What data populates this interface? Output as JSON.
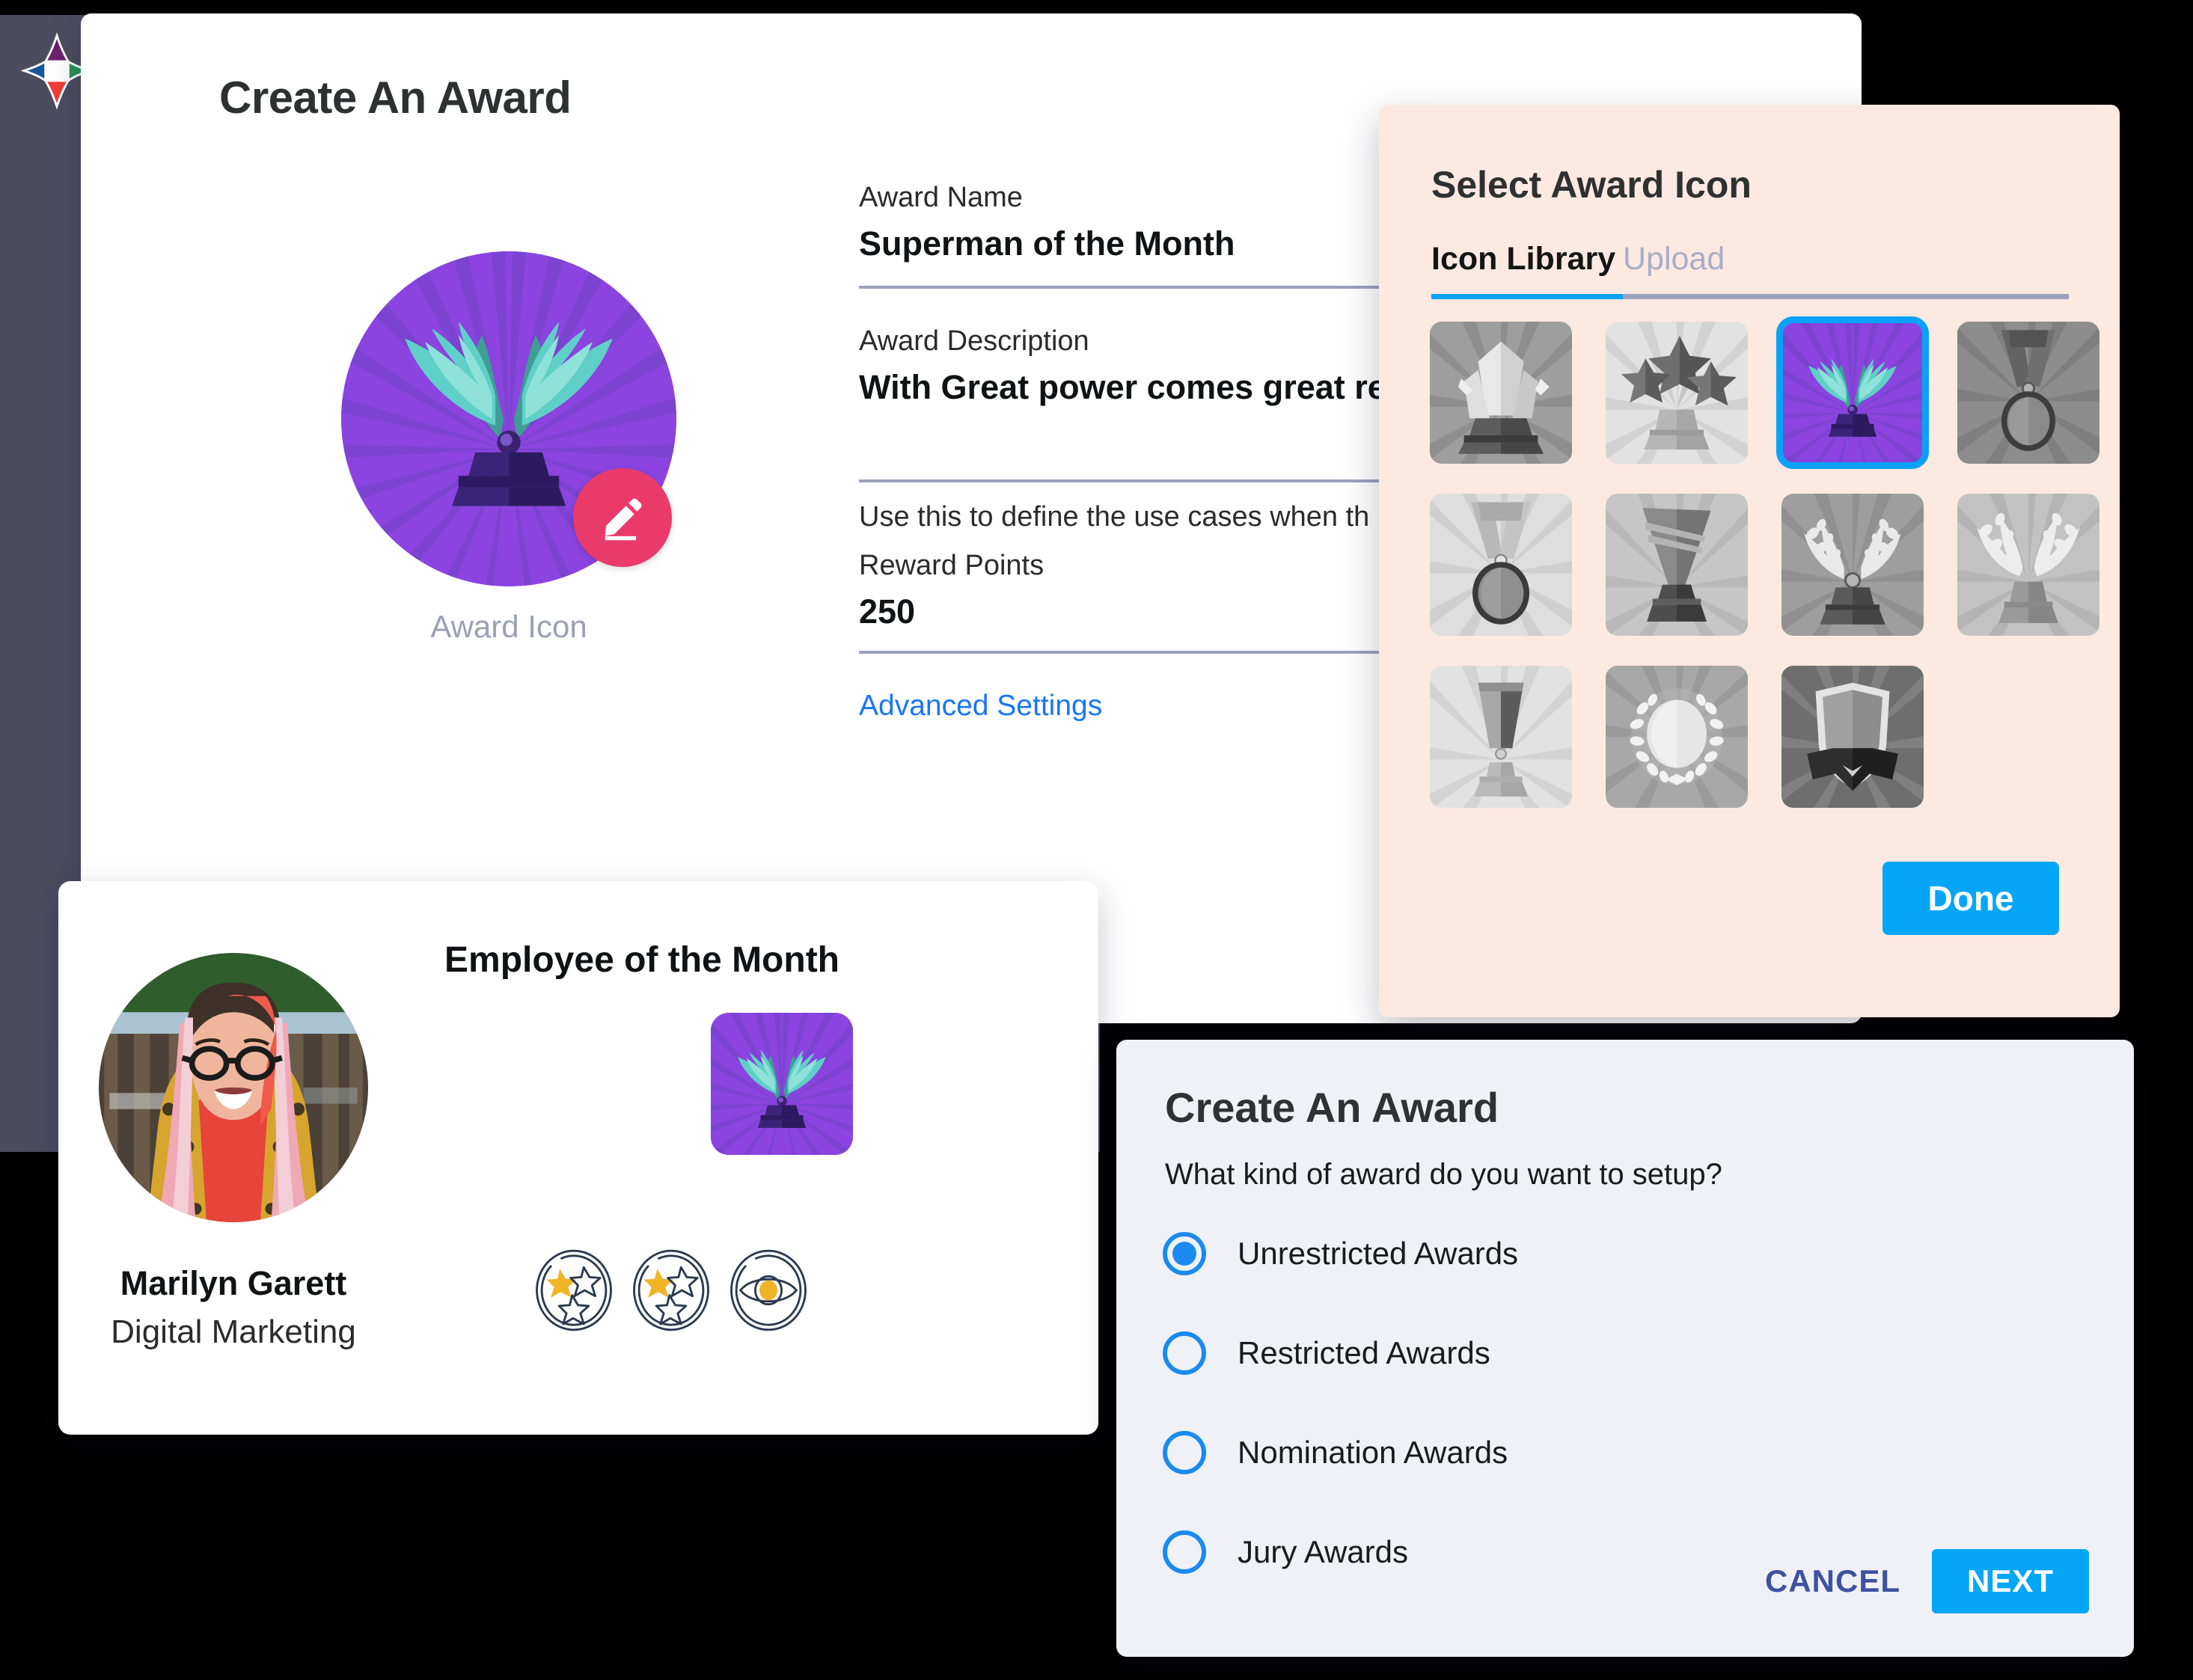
{
  "app": {
    "logo_name": "compass-star-logo",
    "chrome_color": "#4c4c61"
  },
  "main_window": {
    "title": "Create An Award",
    "award_preview": {
      "caption": "Award Icon",
      "edit_icon": "pencil-edit-icon",
      "icon_name": "winged-trophy-purple"
    },
    "form": {
      "name_label": "Award Name",
      "name_value": "Superman of the Month",
      "description_label": "Award Description",
      "description_value": "With Great power comes great respo",
      "description_hint": "Use this to define the use cases when th",
      "points_label": "Reward Points",
      "points_value": "250",
      "advanced_link": "Advanced Settings"
    }
  },
  "employee_card": {
    "photo_alt": "employee-photo",
    "name": "Marilyn Garett",
    "role": "Digital Marketing",
    "award_title": "Employee of the Month",
    "award_thumb_icon": "winged-trophy-purple",
    "badges": [
      {
        "name": "three-stars-badge-gold",
        "filled": true
      },
      {
        "name": "three-stars-badge-gold",
        "filled": true
      },
      {
        "name": "eye-badge-gold",
        "filled": true
      }
    ]
  },
  "icon_panel": {
    "title": "Select Award Icon",
    "tabs": [
      {
        "label": "Icon Library",
        "active": true
      },
      {
        "label": "Upload",
        "active": false
      }
    ],
    "active_tab_color": "#0aa2f7",
    "background_color": "#fce9e2",
    "done_label": "Done",
    "done_color": "#06a6f7",
    "selected_index": 2,
    "icons": [
      {
        "name": "crystal-trophy-icon",
        "tone": "#9a9a9a",
        "selected": false
      },
      {
        "name": "three-stars-trophy-icon",
        "tone": "#dcdcdc",
        "selected": false
      },
      {
        "name": "winged-trophy-icon",
        "tone": "#8b44e0",
        "selected": true
      },
      {
        "name": "ribbon-medal-icon",
        "tone": "#8d8d8d",
        "selected": false
      },
      {
        "name": "round-medal-icon",
        "tone": "#dadada",
        "selected": false
      },
      {
        "name": "cone-trophy-icon",
        "tone": "#c8c8c8",
        "selected": false
      },
      {
        "name": "laurel-wreath-trophy-icon",
        "tone": "#9a9a9a",
        "selected": false
      },
      {
        "name": "laurel-open-trophy-icon",
        "tone": "#c0c0c0",
        "selected": false
      },
      {
        "name": "flute-trophy-icon",
        "tone": "#dedede",
        "selected": false
      },
      {
        "name": "laurel-circle-icon",
        "tone": "#a5a5a5",
        "selected": false
      },
      {
        "name": "shield-banner-icon",
        "tone": "#7a7a7a",
        "selected": false
      }
    ]
  },
  "wizard": {
    "title": "Create An Award",
    "subtitle": "What kind of award do you want to setup?",
    "options": [
      {
        "label": "Unrestricted Awards",
        "selected": true
      },
      {
        "label": "Restricted Awards",
        "selected": false
      },
      {
        "label": "Nomination Awards",
        "selected": false
      },
      {
        "label": "Jury Awards",
        "selected": false
      }
    ],
    "cancel_label": "CANCEL",
    "next_label": "NEXT",
    "accent_color": "#06a6f7",
    "cancel_color": "#3d52a0"
  }
}
